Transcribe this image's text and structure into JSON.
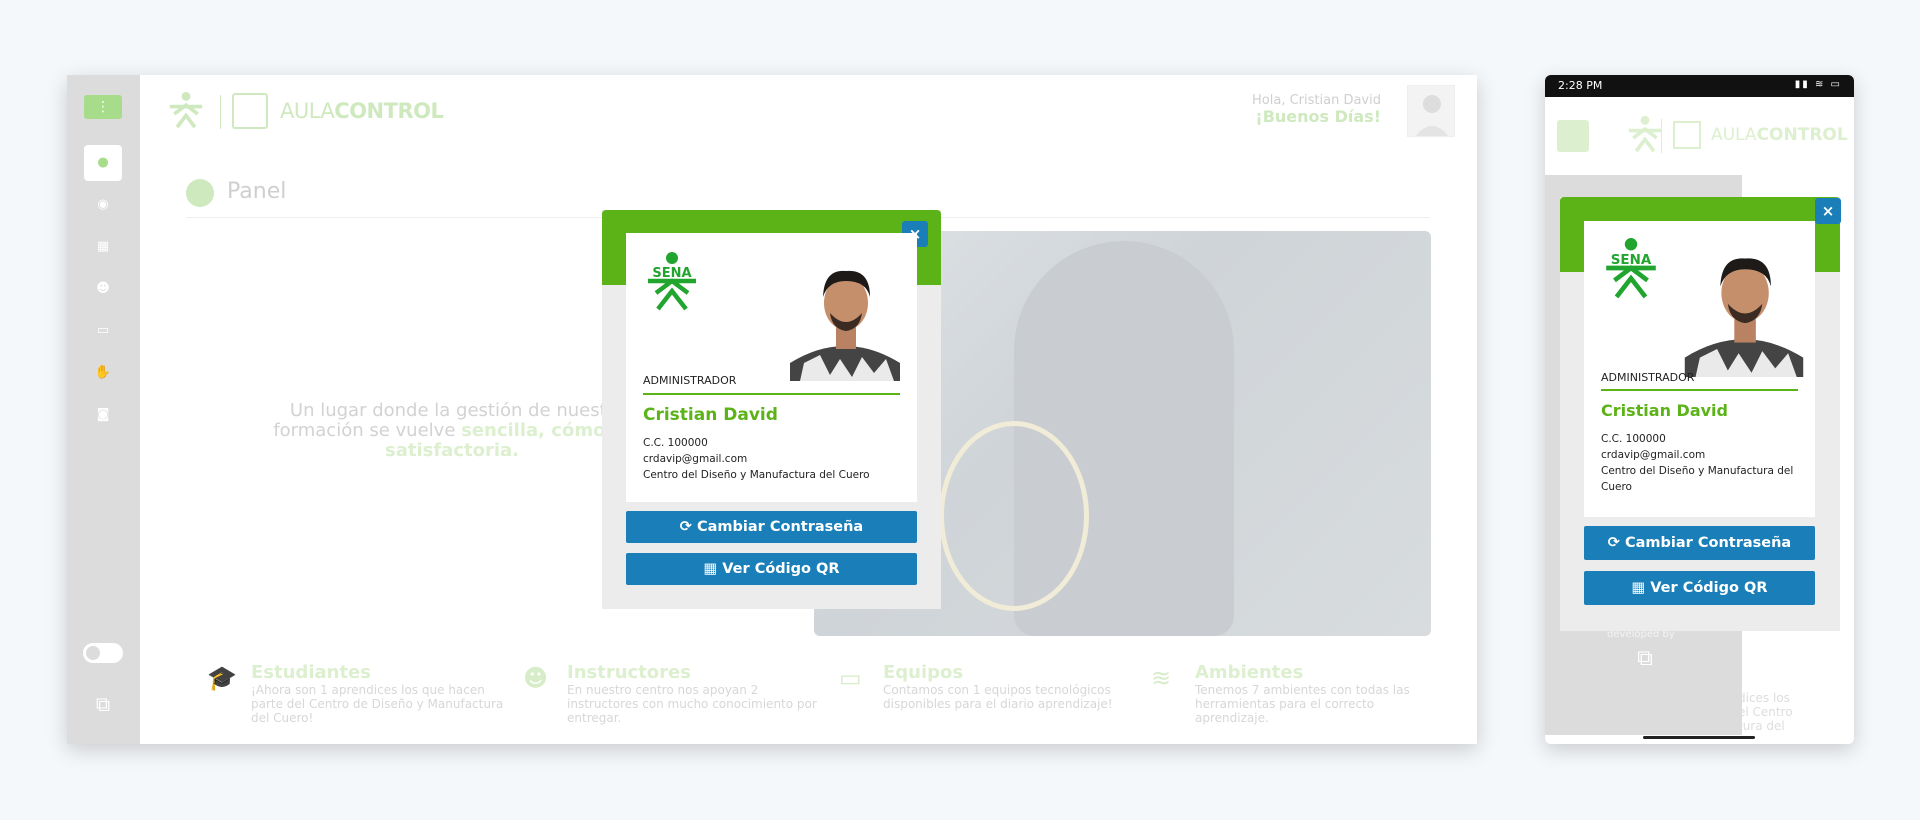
{
  "desktop": {
    "brand": {
      "part1": "AULA",
      "part2": "CONTROL"
    },
    "greeting": {
      "line1": "Hola, Cristian David",
      "line2": "¡Buenos Días!"
    },
    "page_title": "Panel",
    "hero": {
      "line1": "Un lugar donde la gestión de nuestr",
      "line2_prefix": "formación se vuelve ",
      "line2_bold": "sencilla, cómodo",
      "line3_bold": "satisfactoria."
    },
    "features": [
      {
        "title": "Estudiantes",
        "desc": "¡Ahora son 1 aprendices los que hacen parte del Centro de Diseño y Manufactura del Cuero!"
      },
      {
        "title": "Instructores",
        "desc": "En nuestro centro nos apoyan 2 instructores con mucho conocimiento por entregar."
      },
      {
        "title": "Equipos",
        "desc": "Contamos con 1 equipos tecnológicos disponibles para el diario aprendizaje!"
      },
      {
        "title": "Ambientes",
        "desc": "Tenemos 7 ambientes con todas las herramientas para el correcto aprendizaje."
      }
    ]
  },
  "profile": {
    "close": "×",
    "sena_text": "SENA",
    "role": "ADMINISTRADOR",
    "name": "Cristian David",
    "cc": "C.C. 100000",
    "email": "crdavip@gmail.com",
    "center": "Centro del Diseño y Manufactura del Cuero",
    "change_password": "Cambiar Contraseña",
    "view_qr": "Ver Código QR"
  },
  "mobile": {
    "time": "2:28 PM",
    "status_icons": "▮▮ ≋ ▭",
    "brand": {
      "part1": "AULA",
      "part2": "CONTROL"
    },
    "developed_by": "developed by",
    "side_text": "dices los\nel Centro\ntura del"
  },
  "colors": {
    "green": "#5cb318",
    "blue": "#1a7fb8"
  }
}
